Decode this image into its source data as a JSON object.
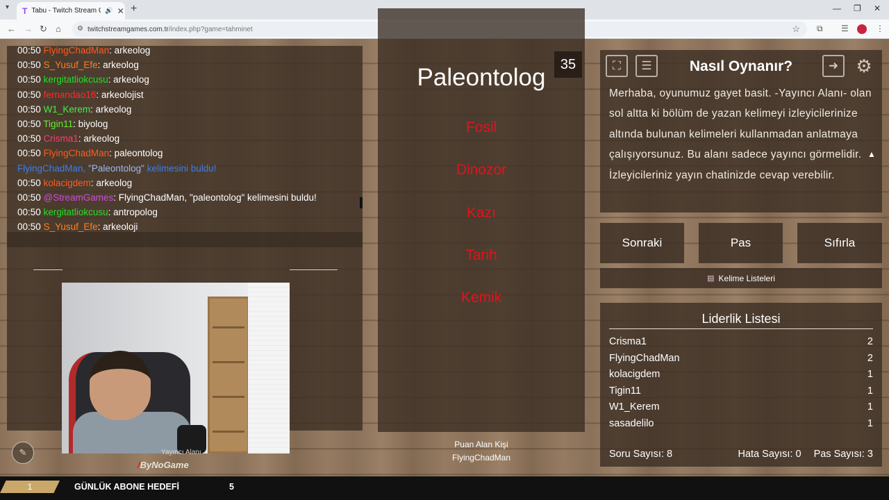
{
  "browser": {
    "tab_title": "Tabu - Twitch Stream Game",
    "tab_logo": "T",
    "url_domain": "twitchstreamgames.com.tr",
    "url_path": "/index.php?game=tahminet",
    "icons": [
      "back-icon",
      "forward-icon",
      "reload-icon",
      "home-icon",
      "site-info-icon",
      "star-icon",
      "extensions-icon",
      "reading-list-icon",
      "profile-icon",
      "menu-icon",
      "minimize-icon",
      "maximize-icon",
      "close-icon"
    ]
  },
  "chat": {
    "lines": [
      {
        "time": "00:50",
        "user": "FlyingChadMan",
        "user_color": "#ff5a1f",
        "msg": ": arkeolog"
      },
      {
        "time": "00:50",
        "user": "S_Yusuf_Efe",
        "user_color": "#ff7f24",
        "msg": ": arkeolog"
      },
      {
        "time": "00:50",
        "user": "kergitatliokcusu",
        "user_color": "#22e022",
        "msg": ": arkeolog"
      },
      {
        "time": "00:50",
        "user": "fernandao16",
        "user_color": "#ff2a2a",
        "msg": ": arkeolojist"
      },
      {
        "time": "00:50",
        "user": "W1_Kerem",
        "user_color": "#44ee44",
        "msg": ": arkeolog"
      },
      {
        "time": "00:50",
        "user": "Tigin11",
        "user_color": "#66ee33",
        "msg": ": biyolog"
      },
      {
        "time": "00:50",
        "user": "Crisma1",
        "user_color": "#ff3d6e",
        "msg": ": arkeolog"
      },
      {
        "time": "00:50",
        "user": "FlyingChadMan",
        "user_color": "#ff5a1f",
        "msg": ": paleontolog"
      },
      {
        "time": "",
        "user": "",
        "user_color": "",
        "msg": ""
      },
      {
        "time": "00:50",
        "user": "kolacigdem",
        "user_color": "#ff5a1f",
        "msg": ": arkeolog"
      },
      {
        "time": "00:50",
        "user": "@StreamGames",
        "user_color": "#d04ad8",
        "msg": ": FlyingChadMan, \"paleontolog\" kelimesini buldu!"
      },
      {
        "time": "00:50",
        "user": "kergitatliokcusu",
        "user_color": "#22e022",
        "msg": ": antropolog"
      },
      {
        "time": "00:50",
        "user": "S_Yusuf_Efe",
        "user_color": "#ff7f24",
        "msg": ": arkeoloji"
      }
    ],
    "system": {
      "name": "FlyingChadMan,",
      "word": "\"Paleontolog\"",
      "rest": " kelimesini buldu!"
    }
  },
  "streamer": {
    "caption": "Yayıncı Alanı",
    "brand": "ByNoGame",
    "brand_mark": "/"
  },
  "card": {
    "timer": "35",
    "word": "Paleontolog",
    "forbidden": [
      "Fosil",
      "Dinozor",
      "Kazı",
      "Tarih",
      "Kemik"
    ],
    "scorer_label": "Puan Alan Kişi",
    "scorer_name": "FlyingChadMan"
  },
  "howto": {
    "title": "Nasıl Oynanır?",
    "text": "Merhaba, oyunumuz gayet basit. -Yayıncı Alanı- olan sol altta ki bölüm de yazan kelimeyi izleyicilerinize altında bulunan kelimeleri kullanmadan anlatmaya çalışıyorsunuz. Bu alanı sadece yayıncı görmelidir. İzleyicileriniz yayın chatinizde cevap verebilir."
  },
  "actions": {
    "next": "Sonraki",
    "pass": "Pas",
    "reset": "Sıfırla",
    "word_lists": "Kelime Listeleri"
  },
  "leaderboard": {
    "title": "Liderlik Listesi",
    "rows": [
      {
        "name": "Crisma1",
        "score": "2"
      },
      {
        "name": "FlyingChadMan",
        "score": "2"
      },
      {
        "name": "kolacigdem",
        "score": "1"
      },
      {
        "name": "Tigin11",
        "score": "1"
      },
      {
        "name": "W1_Kerem",
        "score": "1"
      },
      {
        "name": "sasadelilo",
        "score": "1"
      }
    ],
    "stats": {
      "questions": "Soru Sayısı: 8",
      "errors": "Hata Sayısı: 0",
      "passes": "Pas Sayısı: 3"
    }
  },
  "goal": {
    "current": "1",
    "label": "GÜNLÜK ABONE HEDEFİ",
    "target": "5"
  },
  "colors": {
    "forbidden_red": "#e0141e",
    "panel_bg": "#3a2d23",
    "wood": "#8a7159",
    "system_blue": "#3d7fe8"
  }
}
